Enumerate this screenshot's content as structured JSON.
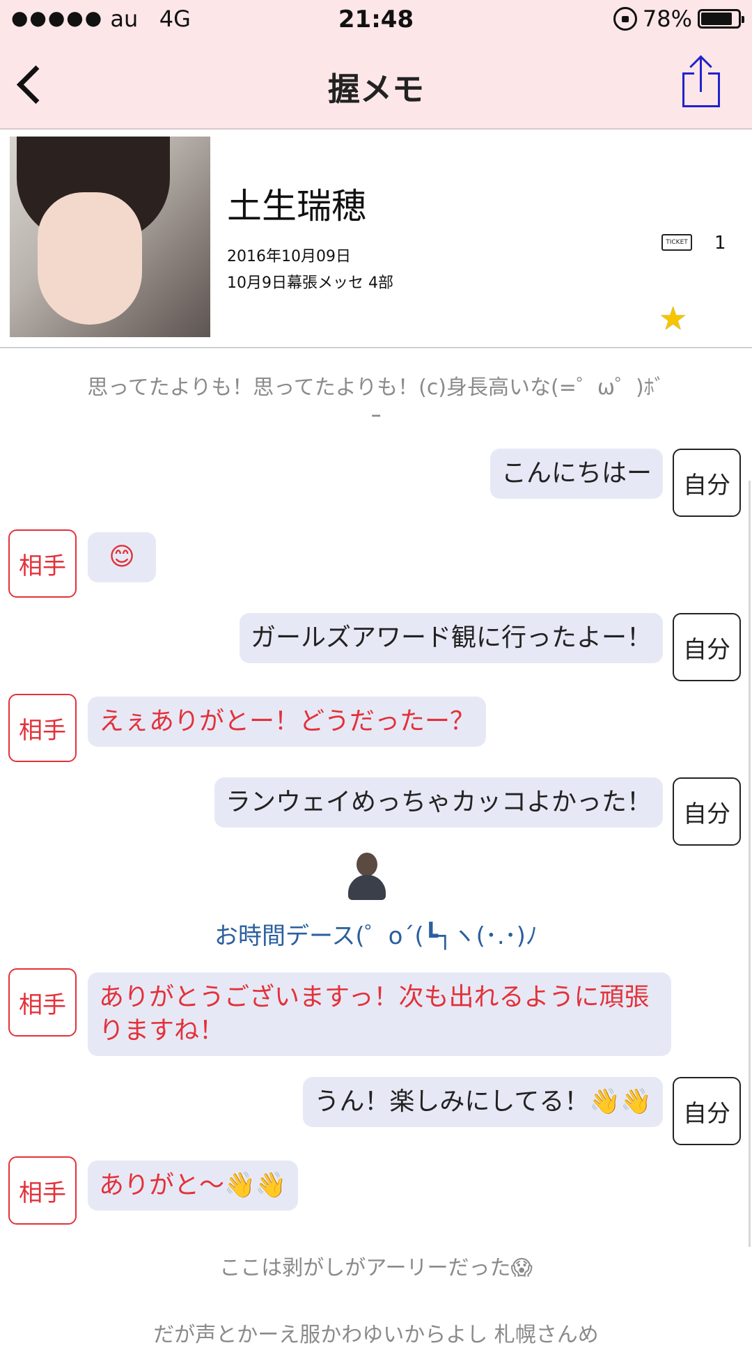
{
  "status": {
    "signal_dots": "●●●●●",
    "carrier": "au",
    "network": "4G",
    "time": "21:48",
    "battery": "78%",
    "battery_level": 0.78
  },
  "nav": {
    "title": "握メモ"
  },
  "profile": {
    "name": "土生瑞穂",
    "date": "2016年10月09日",
    "event": "10月9日幕張メッセ 4部",
    "ticket_label": "TICKET",
    "ticket_count": "1"
  },
  "chat": {
    "note_top": "思ってたよりも！思ってたよりも！(c)身長高いな(=゜ω゜)ﾎﾞｰ",
    "messages": [
      {
        "who": "me",
        "tag": "自分",
        "text": "こんにちはー"
      },
      {
        "who": "them",
        "tag": "相手",
        "text": "😊"
      },
      {
        "who": "me",
        "tag": "自分",
        "text": "ガールズアワード観に行ったよー！"
      },
      {
        "who": "them",
        "tag": "相手",
        "text": "えぇありがとー！どうだったー？"
      },
      {
        "who": "me",
        "tag": "自分",
        "text": "ランウェイめっちゃカッコよかった！"
      },
      {
        "who": "them",
        "tag": "相手",
        "text": "ありがとうございますっ！次も出れるように頑張りますね！"
      },
      {
        "who": "me",
        "tag": "自分",
        "text": "うん！楽しみにしてる！👋👋"
      },
      {
        "who": "them",
        "tag": "相手",
        "text": "ありがと〜👋👋"
      }
    ],
    "staff_line": "お時間デース(゜o´(┗┐ヽ(･.･)ﾉ",
    "note_bottom": "ここは剥がしがアーリーだった😱",
    "note_cut": "だが声とかーえ服かわゆいからよし 札幌さんめ"
  }
}
